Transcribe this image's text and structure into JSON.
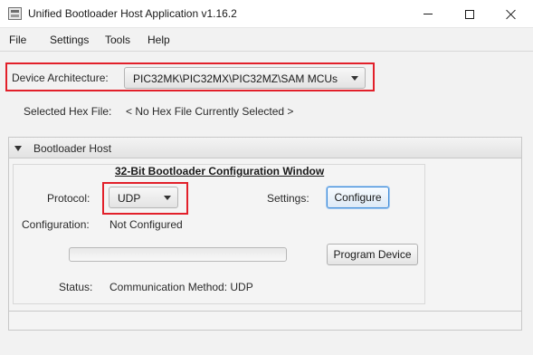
{
  "window": {
    "title": "Unified Bootloader Host Application v1.16.2"
  },
  "menu": {
    "items": [
      "File",
      "Settings",
      "Tools",
      "Help"
    ]
  },
  "device_architecture": {
    "label": "Device Architecture:",
    "value": "PIC32MK\\PIC32MX\\PIC32MZ\\SAM MCUs"
  },
  "hex_file": {
    "label": "Selected Hex File:",
    "value": "< No Hex File Currently Selected >"
  },
  "bootloader_host": {
    "pane_title": "Bootloader Host",
    "section_title": "32-Bit Bootloader Configuration Window",
    "protocol_label": "Protocol:",
    "protocol_value": "UDP",
    "settings_label": "Settings:",
    "configure_button": "Configure",
    "configuration_label": "Configuration:",
    "configuration_value": "Not Configured",
    "progress": 0,
    "program_button": "Program Device",
    "status_label": "Status:",
    "status_value": "Communication Method: UDP"
  },
  "colors": {
    "highlight": "#e2202a",
    "focus_accent": "#3c8ad8"
  }
}
